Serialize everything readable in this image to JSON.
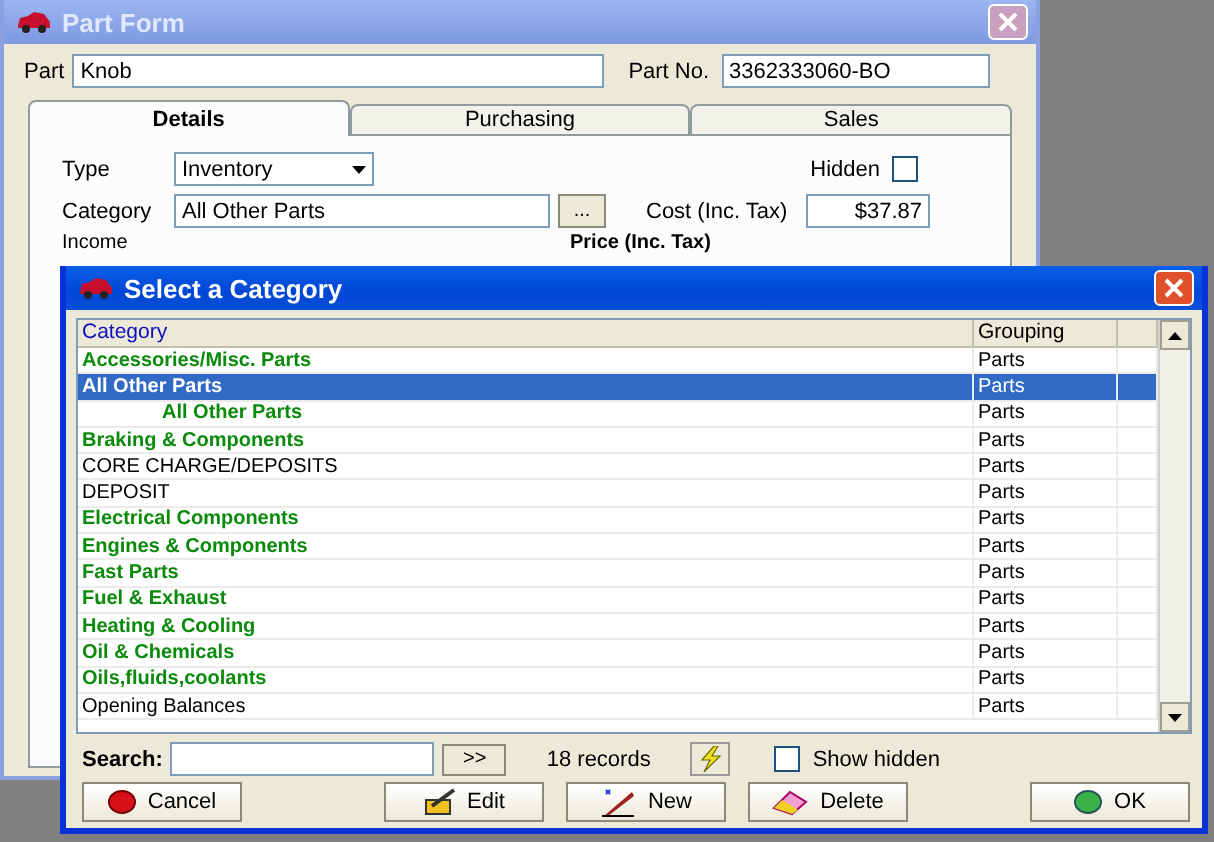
{
  "part_form": {
    "title": "Part Form",
    "part": {
      "label": "Part",
      "value": "Knob"
    },
    "part_no": {
      "label": "Part No.",
      "value": "3362333060-BO"
    },
    "tabs": [
      {
        "label": "Details",
        "selected": true
      },
      {
        "label": "Purchasing",
        "selected": false
      },
      {
        "label": "Sales",
        "selected": false
      }
    ],
    "type": {
      "label": "Type",
      "value": "Inventory"
    },
    "hidden": {
      "label": "Hidden",
      "checked": false
    },
    "category": {
      "label": "Category",
      "value": "All Other Parts",
      "button": "..."
    },
    "cost": {
      "label": "Cost (Inc. Tax)",
      "value": "$37.87"
    },
    "income": {
      "label": "Income"
    },
    "price_heading": "Price (Inc. Tax)"
  },
  "dialog": {
    "title": "Select a Category",
    "columns": [
      "Category",
      "Grouping"
    ],
    "rows": [
      {
        "category": "Accessories/Misc. Parts",
        "grouping": "Parts",
        "kind": "group",
        "selected": false
      },
      {
        "category": "All Other Parts",
        "grouping": "Parts",
        "kind": "group",
        "selected": true,
        "children": [
          {
            "category": "All Other Parts",
            "grouping": "Parts",
            "kind": "group",
            "selected": false
          }
        ]
      },
      {
        "category": "Braking & Components",
        "grouping": "Parts",
        "kind": "group",
        "selected": false
      },
      {
        "category": "CORE CHARGE/DEPOSITS",
        "grouping": "Parts",
        "kind": "plain",
        "selected": false
      },
      {
        "category": "DEPOSIT",
        "grouping": "Parts",
        "kind": "plain",
        "selected": false
      },
      {
        "category": "Electrical Components",
        "grouping": "Parts",
        "kind": "group",
        "selected": false
      },
      {
        "category": "Engines & Components",
        "grouping": "Parts",
        "kind": "group",
        "selected": false
      },
      {
        "category": "Fast Parts",
        "grouping": "Parts",
        "kind": "group",
        "selected": false
      },
      {
        "category": "Fuel & Exhaust",
        "grouping": "Parts",
        "kind": "group",
        "selected": false
      },
      {
        "category": "Heating & Cooling",
        "grouping": "Parts",
        "kind": "group",
        "selected": false
      },
      {
        "category": "Oil & Chemicals",
        "grouping": "Parts",
        "kind": "group",
        "selected": false
      },
      {
        "category": "Oils,fluids,coolants",
        "grouping": "Parts",
        "kind": "group",
        "selected": false
      },
      {
        "category": "Opening Balances",
        "grouping": "Parts",
        "kind": "plain",
        "selected": false
      }
    ],
    "search": {
      "label": "Search:",
      "go": ">>"
    },
    "record_count": "18 records",
    "show_hidden": {
      "label": "Show hidden",
      "checked": false
    },
    "buttons": [
      {
        "label": "Cancel",
        "kind": "cancel"
      },
      {
        "label": "Edit",
        "kind": "edit"
      },
      {
        "label": "New",
        "kind": "new"
      },
      {
        "label": "Delete",
        "kind": "delete"
      },
      {
        "label": "OK",
        "kind": "ok"
      }
    ]
  }
}
